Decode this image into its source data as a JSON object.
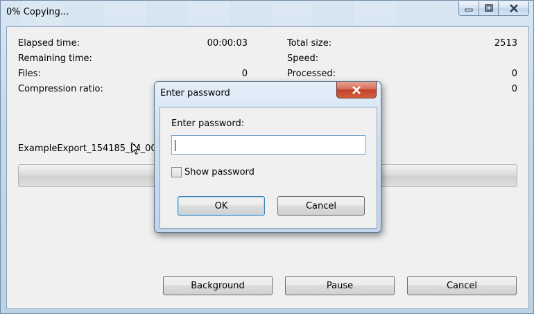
{
  "window": {
    "title": "0% Copying...",
    "controls": [
      "minimize-icon",
      "maximize-icon",
      "close-icon"
    ]
  },
  "stats": {
    "elapsed_label": "Elapsed time:",
    "elapsed_value": "00:00:03",
    "remaining_label": "Remaining time:",
    "files_label": "Files:",
    "files_value": "0",
    "compression_label": "Compression ratio:",
    "total_size_label": "Total size:",
    "total_size_value": "2513",
    "speed_label": "Speed:",
    "processed_label": "Processed:",
    "processed_value": "0",
    "compressed_value": "0"
  },
  "current_file": "ExampleExport_154185_IM_001.c",
  "progress": 0,
  "buttons": {
    "background": "Background",
    "pause": "Pause",
    "cancel": "Cancel"
  },
  "dialog": {
    "title": "Enter password",
    "field_label": "Enter password:",
    "field_value": "",
    "show_password_label": "Show password",
    "show_password_checked": false,
    "ok": "OK",
    "cancel": "Cancel"
  },
  "colors": {
    "frame": "#c6d9ea",
    "client": "#f0f0f0",
    "close_red": "#c1402a",
    "focus_blue": "#3c7fb1"
  }
}
